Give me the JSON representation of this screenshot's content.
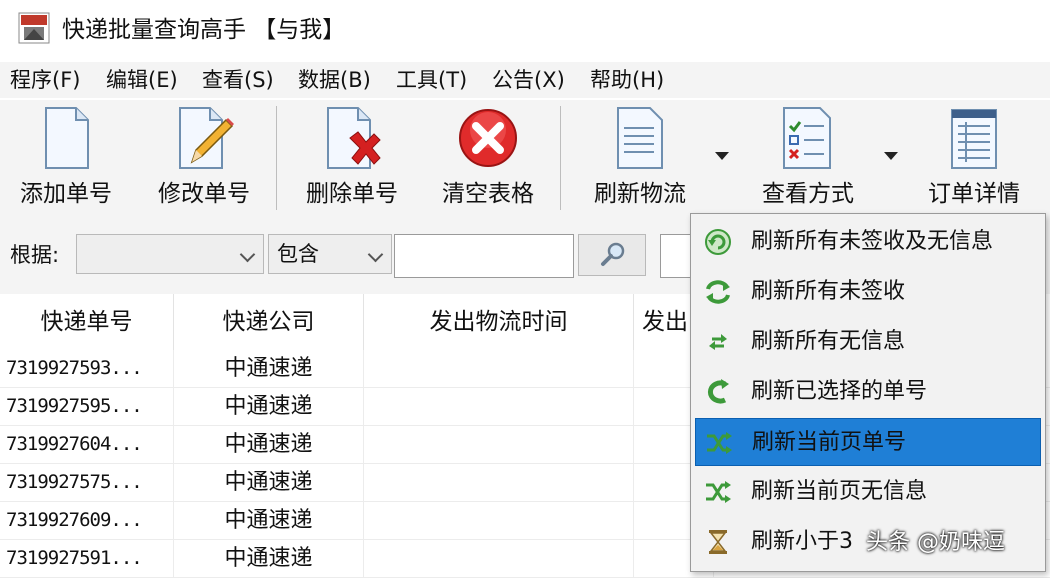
{
  "window": {
    "title": "快递批量查询高手 【与我】"
  },
  "menu": [
    "程序(F)",
    "编辑(E)",
    "查看(S)",
    "数据(B)",
    "工具(T)",
    "公告(X)",
    "帮助(H)"
  ],
  "toolbar": {
    "add": "添加单号",
    "edit": "修改单号",
    "delete": "删除单号",
    "clear": "清空表格",
    "refresh": "刷新物流",
    "view_mode": "查看方式",
    "order_detail": "订单详情"
  },
  "filter": {
    "label": "根据:",
    "field_value": "",
    "match_value": "包含",
    "search_value": ""
  },
  "table": {
    "columns": [
      "快递单号",
      "快递公司",
      "发出物流时间",
      "发出"
    ],
    "rows": [
      {
        "number": "7319927593...",
        "company": "中通速递"
      },
      {
        "number": "7319927595...",
        "company": "中通速递"
      },
      {
        "number": "7319927604...",
        "company": "中通速递"
      },
      {
        "number": "7319927575...",
        "company": "中通速递"
      },
      {
        "number": "7319927609...",
        "company": "中通速递"
      },
      {
        "number": "7319927591...",
        "company": "中通速递"
      }
    ]
  },
  "refresh_menu": {
    "items": [
      {
        "label": "刷新所有未签收及无信息",
        "icon": "refresh-all-icon"
      },
      {
        "label": "刷新所有未签收",
        "icon": "refresh-cycle-icon"
      },
      {
        "label": "刷新所有无信息",
        "icon": "refresh-small-icon"
      },
      {
        "label": "刷新已选择的单号",
        "icon": "refresh-selected-icon"
      },
      {
        "label": "刷新当前页单号",
        "icon": "shuffle-icon"
      },
      {
        "label": "刷新当前页无信息",
        "icon": "shuffle-icon"
      },
      {
        "label": "刷新小于3",
        "icon": "hourglass-icon"
      }
    ],
    "selected_index": 4
  },
  "watermark": "头条 @奶味逗",
  "colors": {
    "selection": "#1f7fd6",
    "delete_red": "#d42020",
    "refresh_green": "#3d9a3a"
  }
}
